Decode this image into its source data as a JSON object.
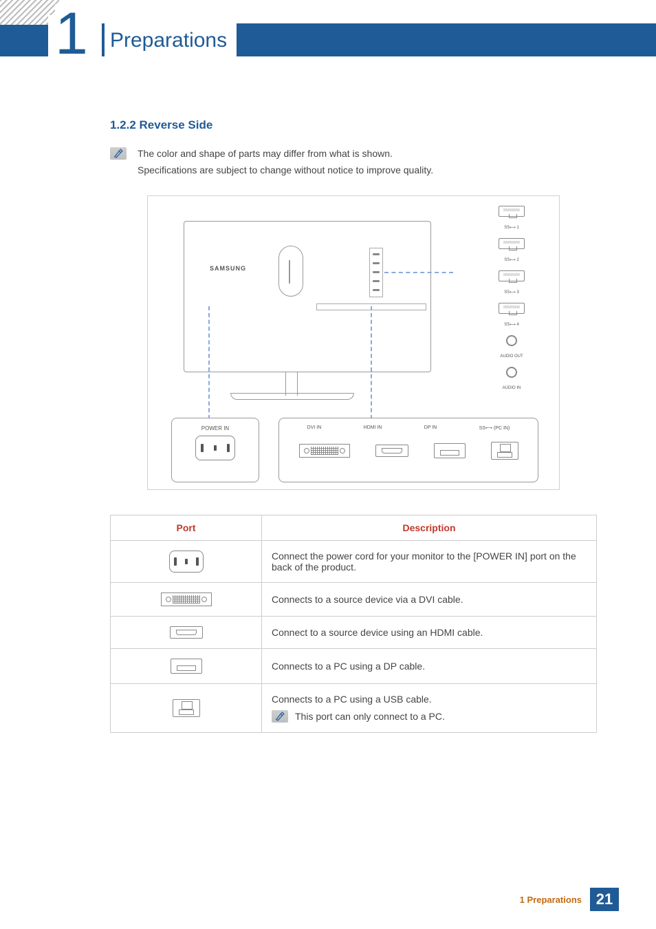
{
  "chapter": {
    "number": "1",
    "title": "Preparations"
  },
  "section": {
    "heading": "1.2.2   Reverse Side",
    "note_line1": "The color and shape of parts may differ from what is shown.",
    "note_line2": "Specifications are subject to change without notice to improve quality."
  },
  "diagram": {
    "brand": "SAMSUNG",
    "side_ports": [
      {
        "label": "SS⟷ 1"
      },
      {
        "label": "SS⟷ 2"
      },
      {
        "label": "SS⟷ 3"
      },
      {
        "label": "SS⟷ 4"
      },
      {
        "label": "AUDIO OUT"
      },
      {
        "label": "AUDIO IN"
      }
    ],
    "power_callout": {
      "label": "POWER IN"
    },
    "ports_callout": {
      "labels": [
        "DVI IN",
        "HDMI IN",
        "DP IN",
        "SS⟷ (PC IN)"
      ]
    }
  },
  "table": {
    "headers": {
      "port": "Port",
      "description": "Description"
    },
    "rows": [
      {
        "port_icon": "power",
        "description": "Connect the power cord for your monitor to the [POWER IN] port on the back of the product."
      },
      {
        "port_icon": "dvi",
        "description": "Connects to a source device via a DVI cable."
      },
      {
        "port_icon": "hdmi",
        "description": "Connect to a source device using an HDMI cable."
      },
      {
        "port_icon": "dp",
        "description": "Connects to a PC using a DP cable."
      },
      {
        "port_icon": "usb-up",
        "description": "Connects to a PC using a USB cable.",
        "note": "This port can only connect to a PC."
      }
    ]
  },
  "footer": {
    "text": "1 Preparations",
    "page": "21"
  }
}
